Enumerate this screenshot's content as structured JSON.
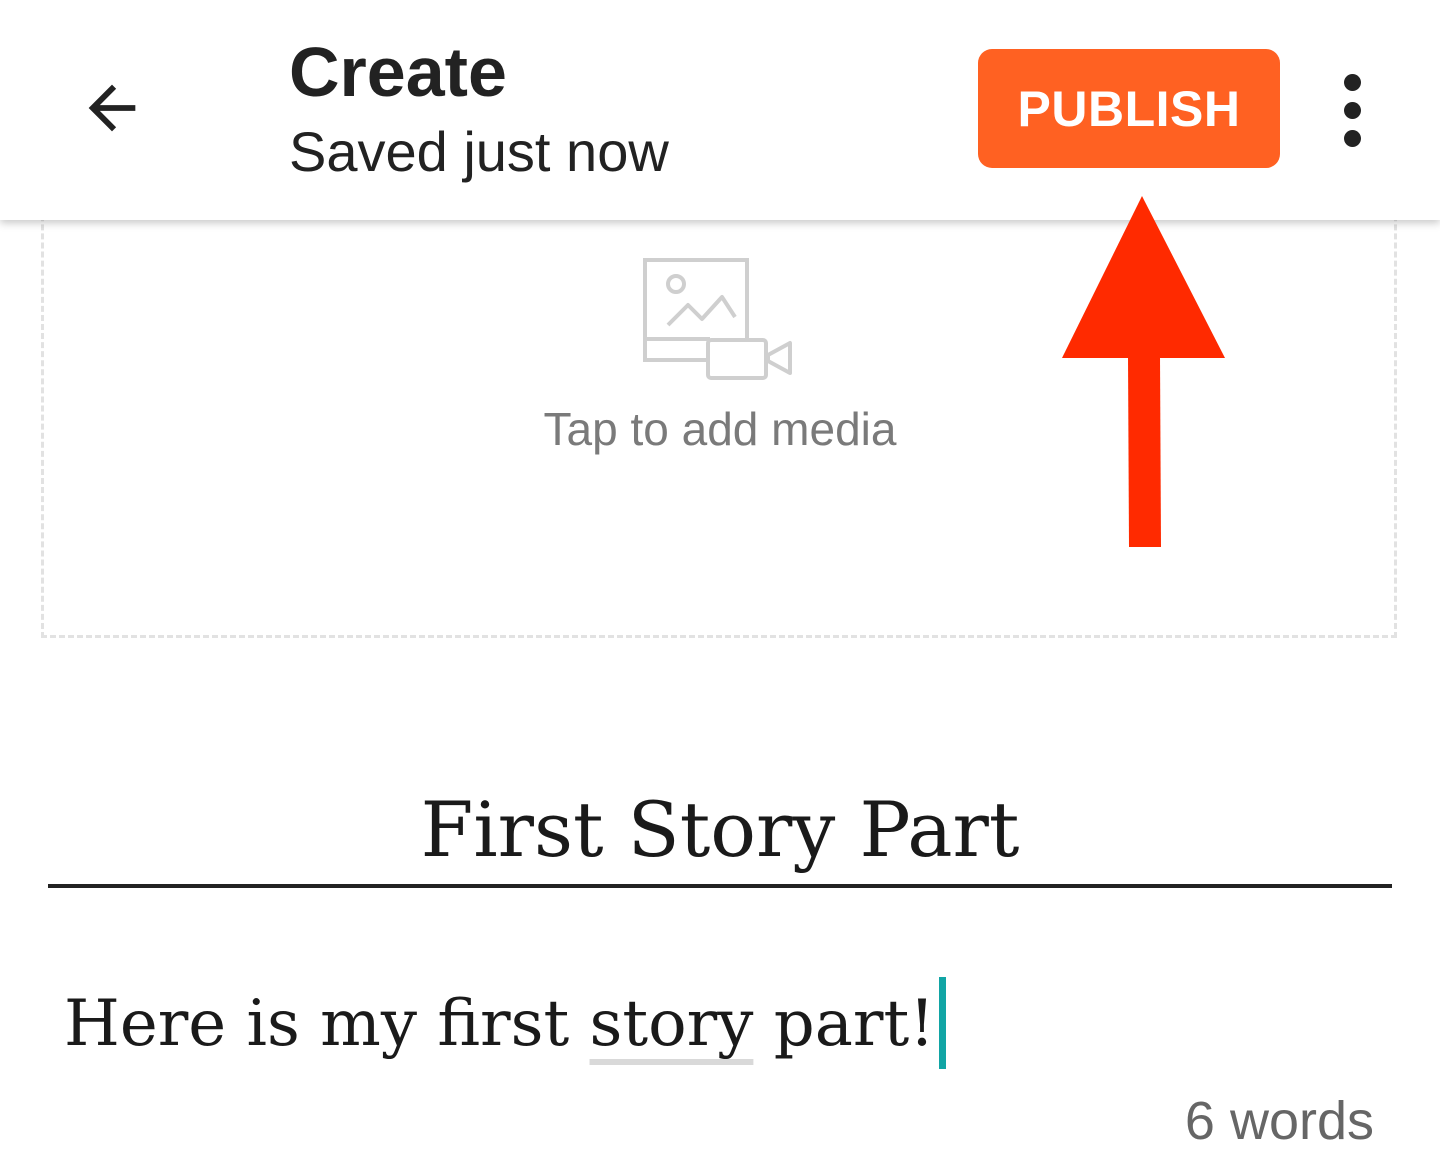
{
  "toolbar": {
    "back_icon": "arrow-back-icon",
    "title": "Create",
    "subtitle": "Saved just now",
    "publish_label": "PUBLISH",
    "overflow_icon": "more-vertical-icon",
    "publish_color": "#ff6122"
  },
  "media": {
    "icon": "image-video-placeholder-icon",
    "label": "Tap to add media"
  },
  "annotation": {
    "icon": "red-up-arrow-icon",
    "color": "#ff2a00"
  },
  "story": {
    "title": "First Story Part",
    "body_before": "Here is my first ",
    "body_underlined": "story",
    "body_after": " part!",
    "caret_color": "#11a5a5",
    "word_count": "6 words"
  }
}
